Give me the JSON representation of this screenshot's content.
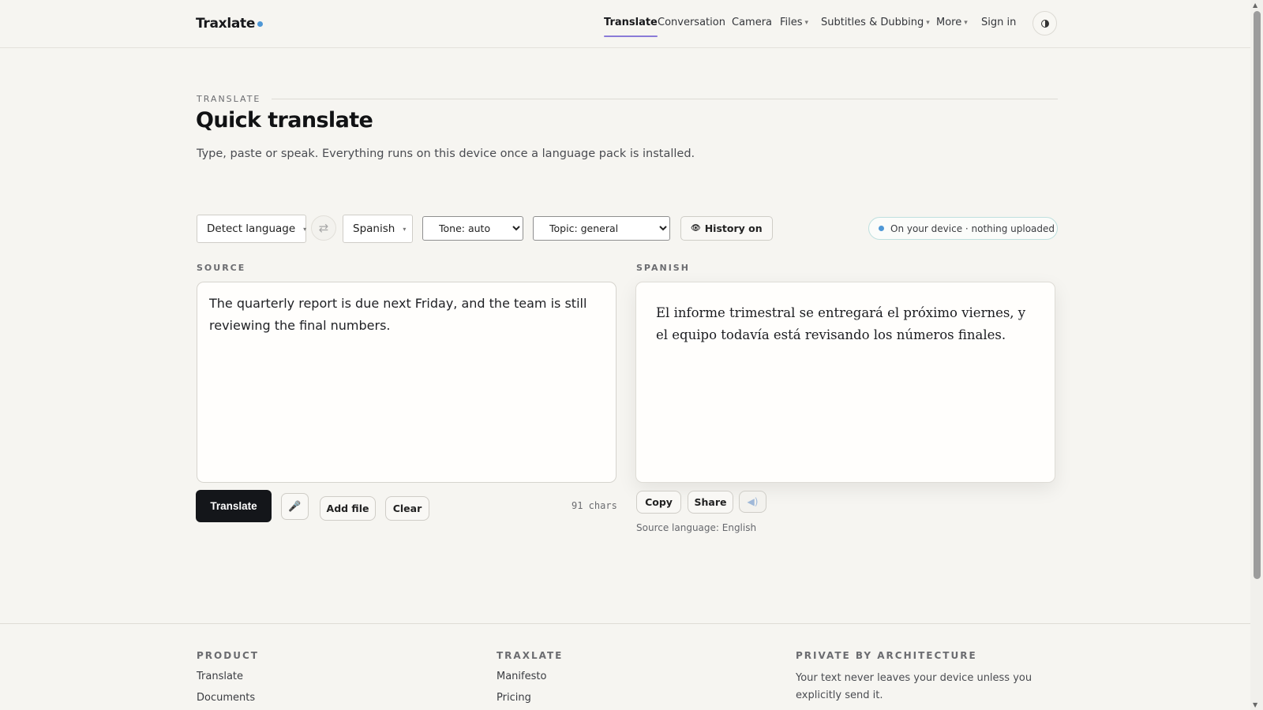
{
  "brand": {
    "name": "Traxlate"
  },
  "nav": {
    "items": [
      {
        "label": "Translate",
        "active": true,
        "dropdown": false
      },
      {
        "label": "Conversation",
        "active": false,
        "dropdown": false
      },
      {
        "label": "Camera",
        "active": false,
        "dropdown": false
      },
      {
        "label": "Files",
        "active": false,
        "dropdown": true
      },
      {
        "label": "Subtitles & Dubbing",
        "active": false,
        "dropdown": true
      },
      {
        "label": "More",
        "active": false,
        "dropdown": true
      },
      {
        "label": "Sign in",
        "active": false,
        "dropdown": false
      }
    ],
    "theme_toggle_icon": "half-moon-icon"
  },
  "intro": {
    "eyebrow": "TRANSLATE",
    "title": "Quick translate",
    "subtitle": "Type, paste or speak. Everything runs on this device once a language pack is installed."
  },
  "toolbar": {
    "source_language": "Detect language",
    "swap_icon": "swap-arrows-icon",
    "target_language": "Spanish",
    "tone": {
      "selected": "Tone: auto"
    },
    "topic": {
      "selected": "Topic: general"
    },
    "history_label": "History on",
    "device_badge": "On your device · nothing uploaded"
  },
  "source": {
    "label": "SOURCE",
    "text": "The quarterly report is due next Friday, and the team is still reviewing the final numbers.",
    "translate_label": "Translate",
    "add_file_label": "Add file",
    "clear_label": "Clear",
    "char_count": "91 chars"
  },
  "target": {
    "label": "SPANISH",
    "text": "El informe trimestral se entregará el próximo viernes, y el equipo todavía está revisando los números finales.",
    "copy_label": "Copy",
    "share_label": "Share",
    "detected_source": "Source language: English"
  },
  "footer": {
    "product_heading": "PRODUCT",
    "product_links": [
      "Translate",
      "Documents"
    ],
    "traxlate_heading": "TRAXLATE",
    "traxlate_links": [
      "Manifesto",
      "Pricing"
    ],
    "privacy_heading": "PRIVATE BY ARCHITECTURE",
    "privacy_text": "Your text never leaves your device unless you explicitly send it."
  },
  "colors": {
    "background": "#f6f5f1",
    "primary_button": "#14161a",
    "accent_dot": "#4e97d6",
    "active_underline": "#8a7bd8"
  }
}
